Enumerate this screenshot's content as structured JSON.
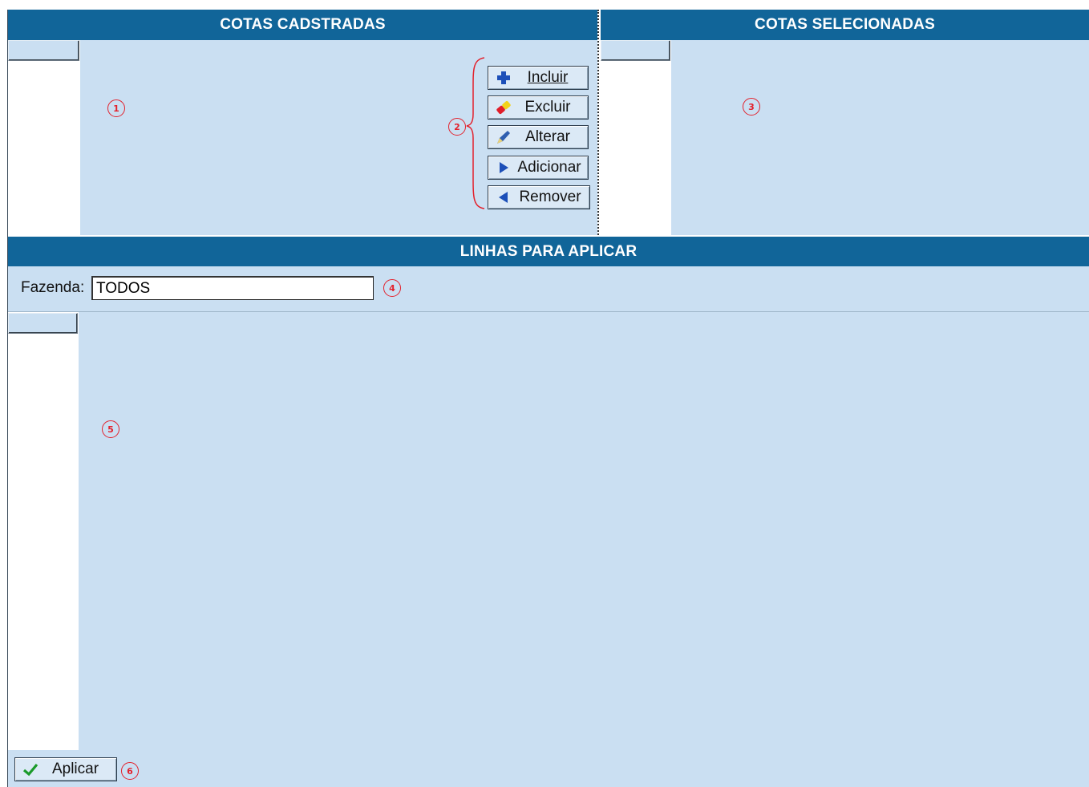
{
  "sections": {
    "cotas_cadastradas": "COTAS CADSTRADAS",
    "cotas_selecionadas": "COTAS SELECIONADAS",
    "linhas_para_aplicar": "LINHAS PARA APLICAR"
  },
  "buttons": {
    "incluir": {
      "label": "Incluir",
      "icon": "plus-icon"
    },
    "excluir": {
      "label": "Excluir",
      "icon": "eraser-icon"
    },
    "alterar": {
      "label": "Alterar",
      "icon": "pencil-icon"
    },
    "adicionar": {
      "label": "Adicionar",
      "icon": "arrow-right-icon"
    },
    "remover": {
      "label": "Remover",
      "icon": "arrow-left-icon"
    },
    "aplicar": {
      "label": "Aplicar",
      "icon": "check-icon"
    }
  },
  "filter": {
    "label": "Fazenda:",
    "value": "TODOS"
  },
  "markers": [
    "1",
    "2",
    "3",
    "4",
    "5",
    "6"
  ],
  "colors": {
    "header_bg": "#116599",
    "panel_bg": "#cadff2",
    "marker": "#e3212c"
  }
}
